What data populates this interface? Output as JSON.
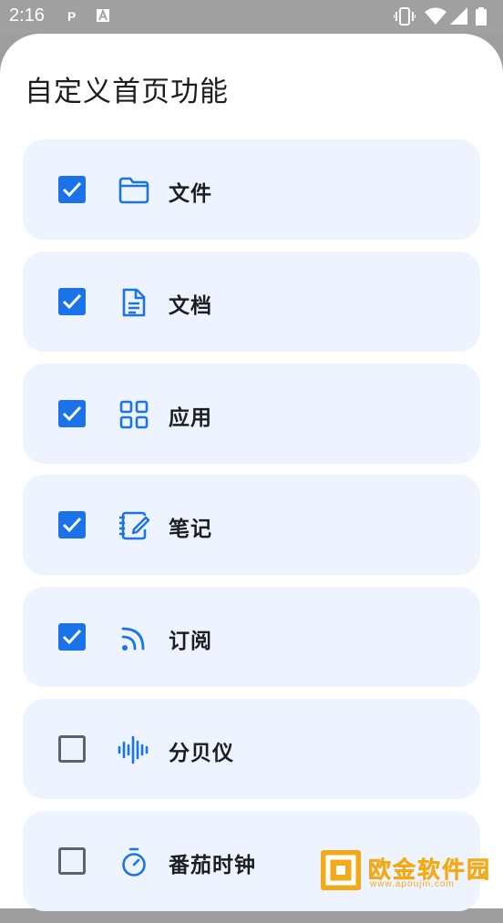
{
  "status_bar": {
    "time": "2:16",
    "notif_p": "P",
    "icons": [
      "a-notification-icon",
      "vibrate-icon",
      "wifi-icon",
      "signal-icon",
      "battery-icon"
    ]
  },
  "sheet": {
    "title": "自定义首页功能"
  },
  "items": [
    {
      "label": "文件",
      "checked": true,
      "icon": "folder-icon"
    },
    {
      "label": "文档",
      "checked": true,
      "icon": "document-icon"
    },
    {
      "label": "应用",
      "checked": true,
      "icon": "apps-grid-icon"
    },
    {
      "label": "笔记",
      "checked": true,
      "icon": "notebook-icon"
    },
    {
      "label": "订阅",
      "checked": true,
      "icon": "rss-icon"
    },
    {
      "label": "分贝仪",
      "checked": false,
      "icon": "sound-wave-icon"
    },
    {
      "label": "番茄时钟",
      "checked": false,
      "icon": "timer-icon"
    }
  ],
  "colors": {
    "accent": "#1a73e8",
    "item_bg": "#eef4ff",
    "unchecked_border": "#5f6368",
    "watermark": "#f2a91a"
  },
  "watermark": {
    "text": "欧金软件园",
    "sub": "www.apoujin.com"
  }
}
